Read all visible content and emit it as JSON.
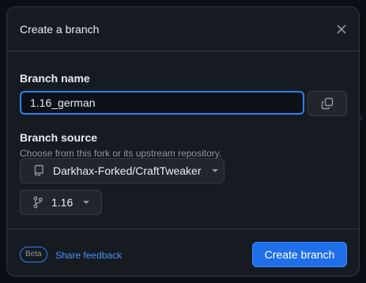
{
  "dialog": {
    "title": "Create a branch"
  },
  "branch_name": {
    "label": "Branch name",
    "value": "1.16_german"
  },
  "branch_source": {
    "label": "Branch source",
    "help": "Choose from this fork or its upstream repository.",
    "repository": "Darkhax-Forked/CraftTweaker",
    "ref": "1.16"
  },
  "footer": {
    "badge": "Beta",
    "feedback_link": "Share feedback",
    "create_button": "Create branch"
  },
  "icons": {
    "close": "x-icon",
    "copy": "copy-icon",
    "repo": "repo-icon",
    "branch": "git-branch-icon",
    "caret": "triangle-down-icon"
  },
  "colors": {
    "accent": "#2f81f7",
    "primary_button": "#1f6feb",
    "link": "#4493f8"
  }
}
